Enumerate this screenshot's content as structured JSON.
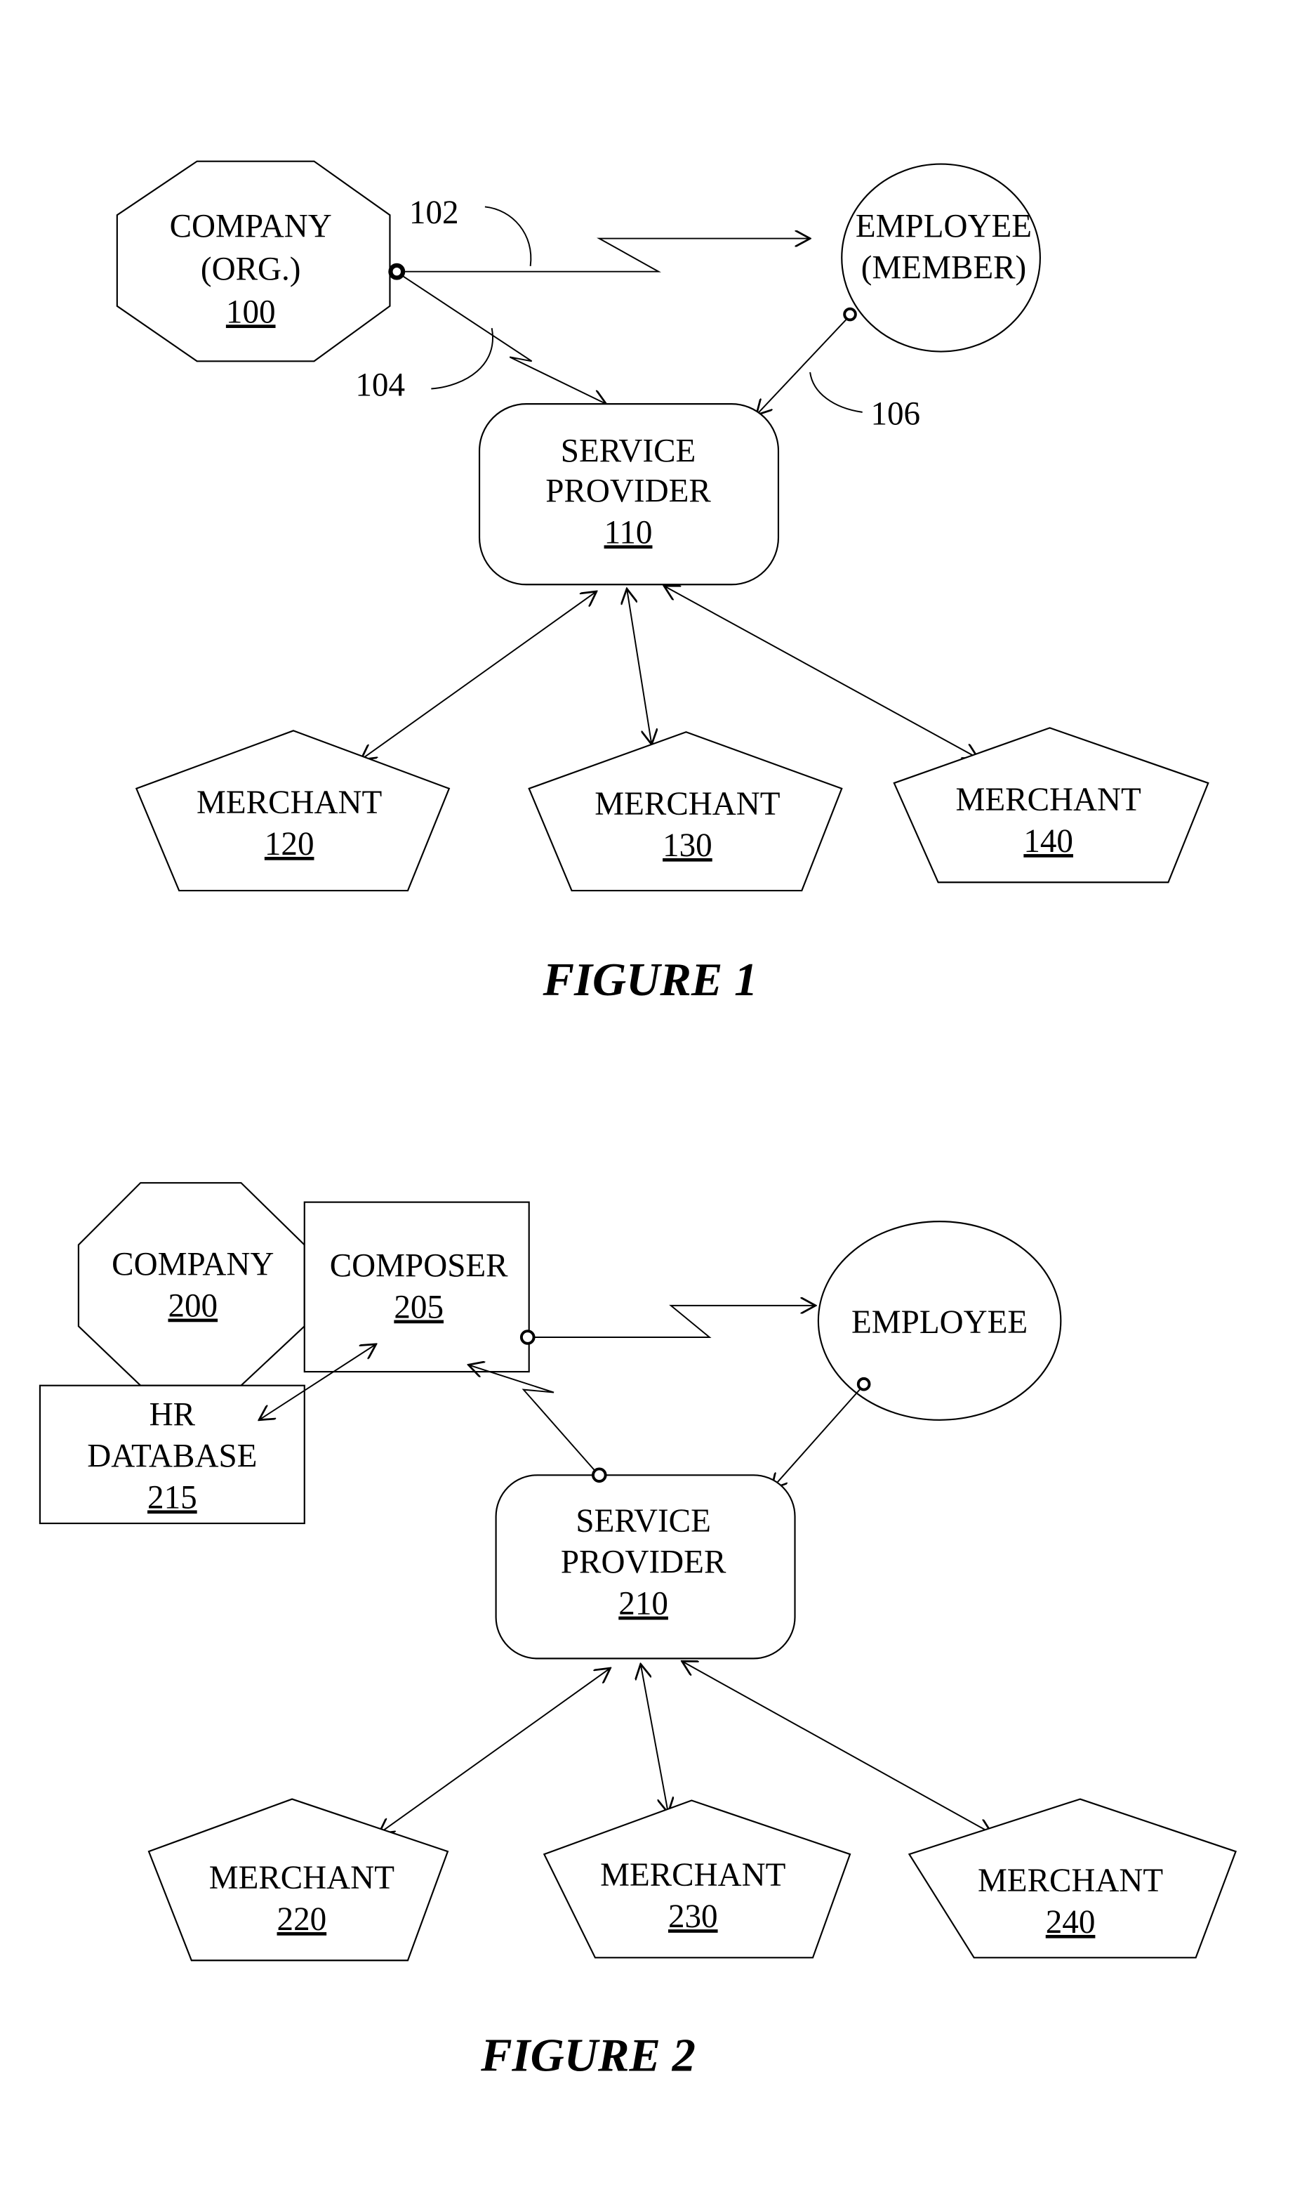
{
  "figure1": {
    "caption": "FIGURE 1",
    "company": {
      "line1": "COMPANY",
      "line2": "(ORG.)",
      "ref": "100"
    },
    "employee": {
      "line1": "EMPLOYEE",
      "line2": "(MEMBER)"
    },
    "service_provider": {
      "line1": "SERVICE",
      "line2": "PROVIDER",
      "ref": "110"
    },
    "merchants": [
      {
        "label": "MERCHANT",
        "ref": "120"
      },
      {
        "label": "MERCHANT",
        "ref": "130"
      },
      {
        "label": "MERCHANT",
        "ref": "140"
      }
    ],
    "callouts": {
      "link_company_employee": "102",
      "link_company_provider": "104",
      "link_employee_provider": "106"
    }
  },
  "figure2": {
    "caption": "FIGURE 2",
    "company": {
      "line1": "COMPANY",
      "ref": "200"
    },
    "composer": {
      "line1": "COMPOSER",
      "ref": "205"
    },
    "hr_database": {
      "line1": "HR",
      "line2": "DATABASE",
      "ref": "215"
    },
    "employee": {
      "line1": "EMPLOYEE"
    },
    "service_provider": {
      "line1": "SERVICE",
      "line2": "PROVIDER",
      "ref": "210"
    },
    "merchants": [
      {
        "label": "MERCHANT",
        "ref": "220"
      },
      {
        "label": "MERCHANT",
        "ref": "230"
      },
      {
        "label": "MERCHANT",
        "ref": "240"
      }
    ]
  }
}
